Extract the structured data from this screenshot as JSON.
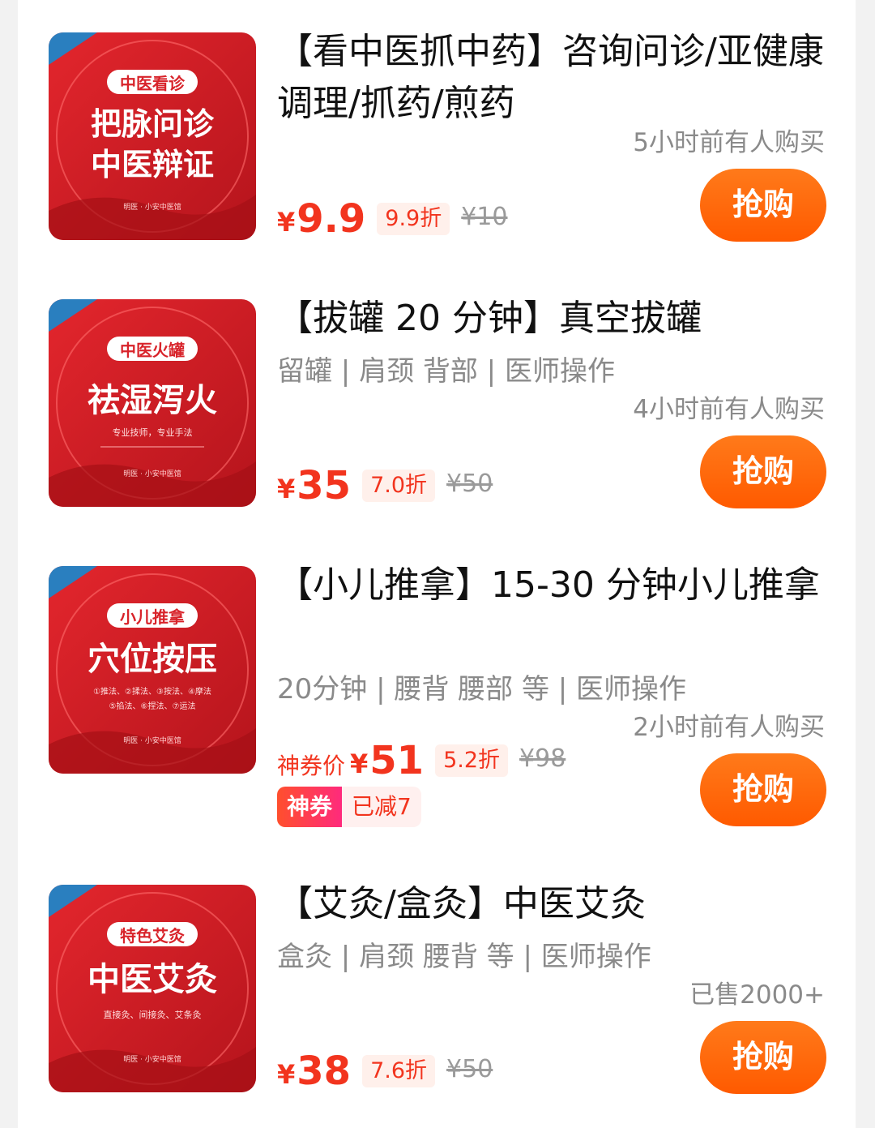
{
  "colors": {
    "accent": "#f2341e",
    "button": "#ff6a00",
    "thumb_red": "#d8232a"
  },
  "items": [
    {
      "thumb": {
        "badge": "中医看诊",
        "main1": "把脉问诊",
        "main2": "中医辩证",
        "slogan": "",
        "brand": "明医 · 小安中医馆"
      },
      "title": "【看中医抓中药】咨询问诊/亚健康调理/抓药/煎药",
      "subtitle": "",
      "sold": "5小时前有人购买",
      "currency": "¥",
      "price": "9.9",
      "discount": "9.9折",
      "original": "¥10",
      "button": "抢购"
    },
    {
      "thumb": {
        "badge": "中医火罐",
        "main1": "祛湿泻火",
        "main2": "",
        "slogan": "专业技师，专业手法",
        "brand": "明医 · 小安中医馆"
      },
      "title": "【拔罐 20 分钟】真空拔罐",
      "subtitle": "留罐 | 肩颈 背部 | 医师操作",
      "sold": "4小时前有人购买",
      "currency": "¥",
      "price": "35",
      "discount": "7.0折",
      "original": "¥50",
      "button": "抢购"
    },
    {
      "thumb": {
        "badge": "小儿推拿",
        "main1": "穴位按压",
        "main2": "",
        "slogan": "①推法、②揉法、③按法、④摩法",
        "slogan2": "⑤掐法、⑥捏法、⑦运法",
        "brand": "明医 · 小安中医馆"
      },
      "title": "【小儿推拿】15-30 分钟小儿推拿",
      "subtitle": "20分钟 | 腰背 腰部 等 | 医师操作",
      "sold": "2小时前有人购买",
      "price_prefix": "神券价",
      "currency": "¥",
      "price": "51",
      "discount": "5.2折",
      "original": "¥98",
      "coupon_tag": "神券",
      "coupon_value": "已减7",
      "button": "抢购"
    },
    {
      "thumb": {
        "badge": "特色艾灸",
        "main1": "中医艾灸",
        "main2": "",
        "slogan": "直接灸、间接灸、艾条灸",
        "brand": "明医 · 小安中医馆"
      },
      "title": "【艾灸/盒灸】中医艾灸",
      "subtitle": "盒灸 | 肩颈 腰背 等 | 医师操作",
      "sold": "已售2000+",
      "currency": "¥",
      "price": "38",
      "discount": "7.6折",
      "original": "¥50",
      "button": "抢购"
    }
  ]
}
